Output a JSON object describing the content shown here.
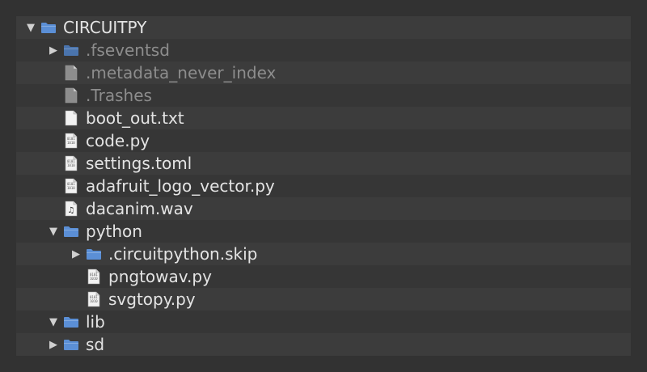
{
  "tree": {
    "items": [
      {
        "label": "CIRCUITPY",
        "icon": "folder-icon",
        "state": "expanded",
        "depth": 0,
        "dim": false
      },
      {
        "label": ".fseventsd",
        "icon": "folder-icon",
        "state": "collapsed",
        "depth": 1,
        "dim": true
      },
      {
        "label": ".metadata_never_index",
        "icon": "document-icon",
        "state": "leaf",
        "depth": 1,
        "dim": true
      },
      {
        "label": ".Trashes",
        "icon": "document-icon",
        "state": "leaf",
        "depth": 1,
        "dim": true
      },
      {
        "label": "boot_out.txt",
        "icon": "text-file-icon",
        "state": "leaf",
        "depth": 1,
        "dim": false
      },
      {
        "label": "code.py",
        "icon": "code-file-icon",
        "state": "leaf",
        "depth": 1,
        "dim": false
      },
      {
        "label": "settings.toml",
        "icon": "code-file-icon",
        "state": "leaf",
        "depth": 1,
        "dim": false
      },
      {
        "label": "adafruit_logo_vector.py",
        "icon": "code-file-icon",
        "state": "leaf",
        "depth": 1,
        "dim": false
      },
      {
        "label": "dacanim.wav",
        "icon": "audio-file-icon",
        "state": "leaf",
        "depth": 1,
        "dim": false
      },
      {
        "label": "python",
        "icon": "folder-icon",
        "state": "expanded",
        "depth": 1,
        "dim": false
      },
      {
        "label": ".circuitpython.skip",
        "icon": "folder-icon",
        "state": "collapsed",
        "depth": 2,
        "dim": false
      },
      {
        "label": "pngtowav.py",
        "icon": "code-file-icon",
        "state": "leaf",
        "depth": 2,
        "dim": false
      },
      {
        "label": "svgtopy.py",
        "icon": "code-file-icon",
        "state": "leaf",
        "depth": 2,
        "dim": false
      },
      {
        "label": "lib",
        "icon": "folder-icon",
        "state": "expanded",
        "depth": 1,
        "dim": false
      },
      {
        "label": "sd",
        "icon": "folder-icon",
        "state": "collapsed",
        "depth": 1,
        "dim": false
      }
    ]
  },
  "glyphs": {
    "expanded": "▼",
    "collapsed": "▶"
  },
  "colors": {
    "folder": "#5b8fd6",
    "folder_dim": "#4a74ad",
    "document": "#f2f2f2",
    "document_dim": "#8d8d8d"
  }
}
